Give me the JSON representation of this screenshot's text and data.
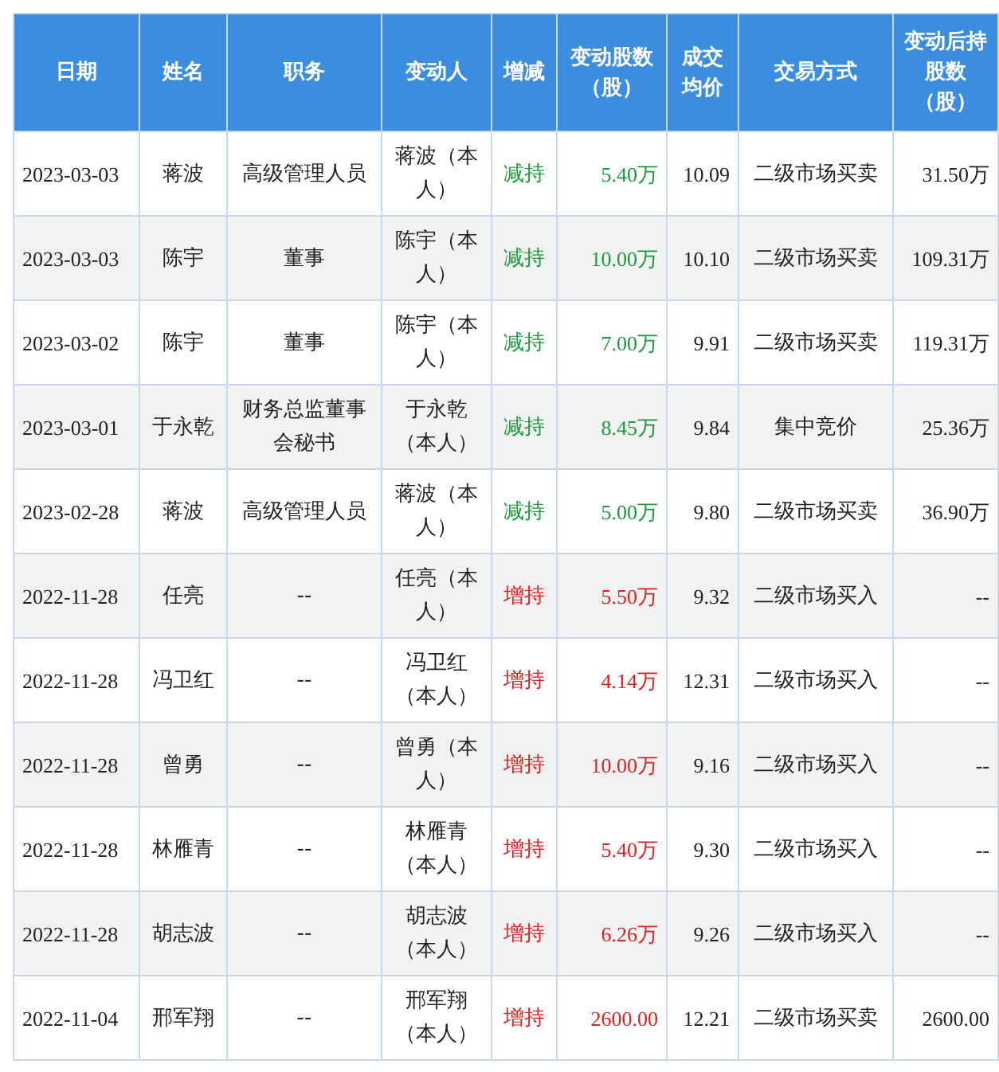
{
  "table": {
    "columns": [
      "日期",
      "姓名",
      "职务",
      "变动人",
      "增减",
      "变动股数（股）",
      "成交均价",
      "交易方式",
      "变动后持股数（股）"
    ],
    "rows": [
      {
        "kind": "sell",
        "cells": [
          "2023-03-03",
          "蒋波",
          "高级管理人员",
          "蒋波（本人）",
          "减持",
          "5.40万",
          "10.09",
          "二级市场买卖",
          "31.50万"
        ]
      },
      {
        "kind": "sell",
        "cells": [
          "2023-03-03",
          "陈宇",
          "董事",
          "陈宇（本人）",
          "减持",
          "10.00万",
          "10.10",
          "二级市场买卖",
          "109.31万"
        ]
      },
      {
        "kind": "sell",
        "cells": [
          "2023-03-02",
          "陈宇",
          "董事",
          "陈宇（本人）",
          "减持",
          "7.00万",
          "9.91",
          "二级市场买卖",
          "119.31万"
        ]
      },
      {
        "kind": "sell",
        "cells": [
          "2023-03-01",
          "于永乾",
          "财务总监董事会秘书",
          "于永乾（本人）",
          "减持",
          "8.45万",
          "9.84",
          "集中竞价",
          "25.36万"
        ]
      },
      {
        "kind": "sell",
        "cells": [
          "2023-02-28",
          "蒋波",
          "高级管理人员",
          "蒋波（本人）",
          "减持",
          "5.00万",
          "9.80",
          "二级市场买卖",
          "36.90万"
        ]
      },
      {
        "kind": "buy",
        "cells": [
          "2022-11-28",
          "任亮",
          "--",
          "任亮（本人）",
          "增持",
          "5.50万",
          "9.32",
          "二级市场买入",
          "--"
        ]
      },
      {
        "kind": "buy",
        "cells": [
          "2022-11-28",
          "冯卫红",
          "--",
          "冯卫红（本人）",
          "增持",
          "4.14万",
          "12.31",
          "二级市场买入",
          "--"
        ]
      },
      {
        "kind": "buy",
        "cells": [
          "2022-11-28",
          "曾勇",
          "--",
          "曾勇（本人）",
          "增持",
          "10.00万",
          "9.16",
          "二级市场买入",
          "--"
        ]
      },
      {
        "kind": "buy",
        "cells": [
          "2022-11-28",
          "林雁青",
          "--",
          "林雁青（本人）",
          "增持",
          "5.40万",
          "9.30",
          "二级市场买入",
          "--"
        ]
      },
      {
        "kind": "buy",
        "cells": [
          "2022-11-28",
          "胡志波",
          "--",
          "胡志波（本人）",
          "增持",
          "6.26万",
          "9.26",
          "二级市场买入",
          "--"
        ]
      },
      {
        "kind": "buy",
        "cells": [
          "2022-11-04",
          "邢军翔",
          "--",
          "邢军翔（本人）",
          "增持",
          "2600.00",
          "12.21",
          "二级市场买卖",
          "2600.00"
        ]
      }
    ]
  }
}
